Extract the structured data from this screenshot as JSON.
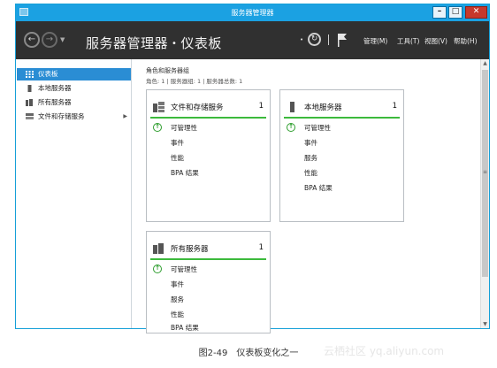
{
  "window": {
    "title": "服务器管理器",
    "buttons": {
      "minimize": "–",
      "maximize": "□",
      "close": "✕"
    }
  },
  "header": {
    "breadcrumb_root": "服务器管理器",
    "breadcrumb_separator": "•",
    "breadcrumb_current": "仪表板",
    "menu": [
      "管理(M)",
      "工具(T)",
      "视图(V)",
      "帮助(H)"
    ]
  },
  "sidebar": {
    "items": [
      {
        "label": "仪表板",
        "icon": "dashboard-icon",
        "active": true
      },
      {
        "label": "本地服务器",
        "icon": "server-icon",
        "active": false
      },
      {
        "label": "所有服务器",
        "icon": "servers-icon",
        "active": false
      },
      {
        "label": "文件和存储服务",
        "icon": "storage-icon",
        "active": false,
        "has_arrow": true
      }
    ]
  },
  "dashboard": {
    "group_title": "角色和服务器组",
    "group_stats": "角色: 1 | 服务器组: 1 | 服务器总数: 1",
    "tiles": [
      {
        "name": "文件和存储服务",
        "count": "1",
        "rows": [
          "可管理性",
          "事件",
          "性能",
          "BPA 结果"
        ]
      },
      {
        "name": "本地服务器",
        "count": "1",
        "rows": [
          "可管理性",
          "事件",
          "服务",
          "性能",
          "BPA 结果"
        ]
      },
      {
        "name": "所有服务器",
        "count": "1",
        "rows": [
          "可管理性",
          "事件",
          "服务",
          "性能",
          "BPA 结果"
        ]
      }
    ]
  },
  "caption": {
    "figure": "图2-49",
    "text": "仪表板变化之一",
    "watermark": "云栖社区 yq.aliyun.com"
  },
  "colors": {
    "titlebar": "#1ba1e2",
    "header": "#303030",
    "active_nav": "#2a8dd4",
    "status_green": "#3cba3c"
  }
}
